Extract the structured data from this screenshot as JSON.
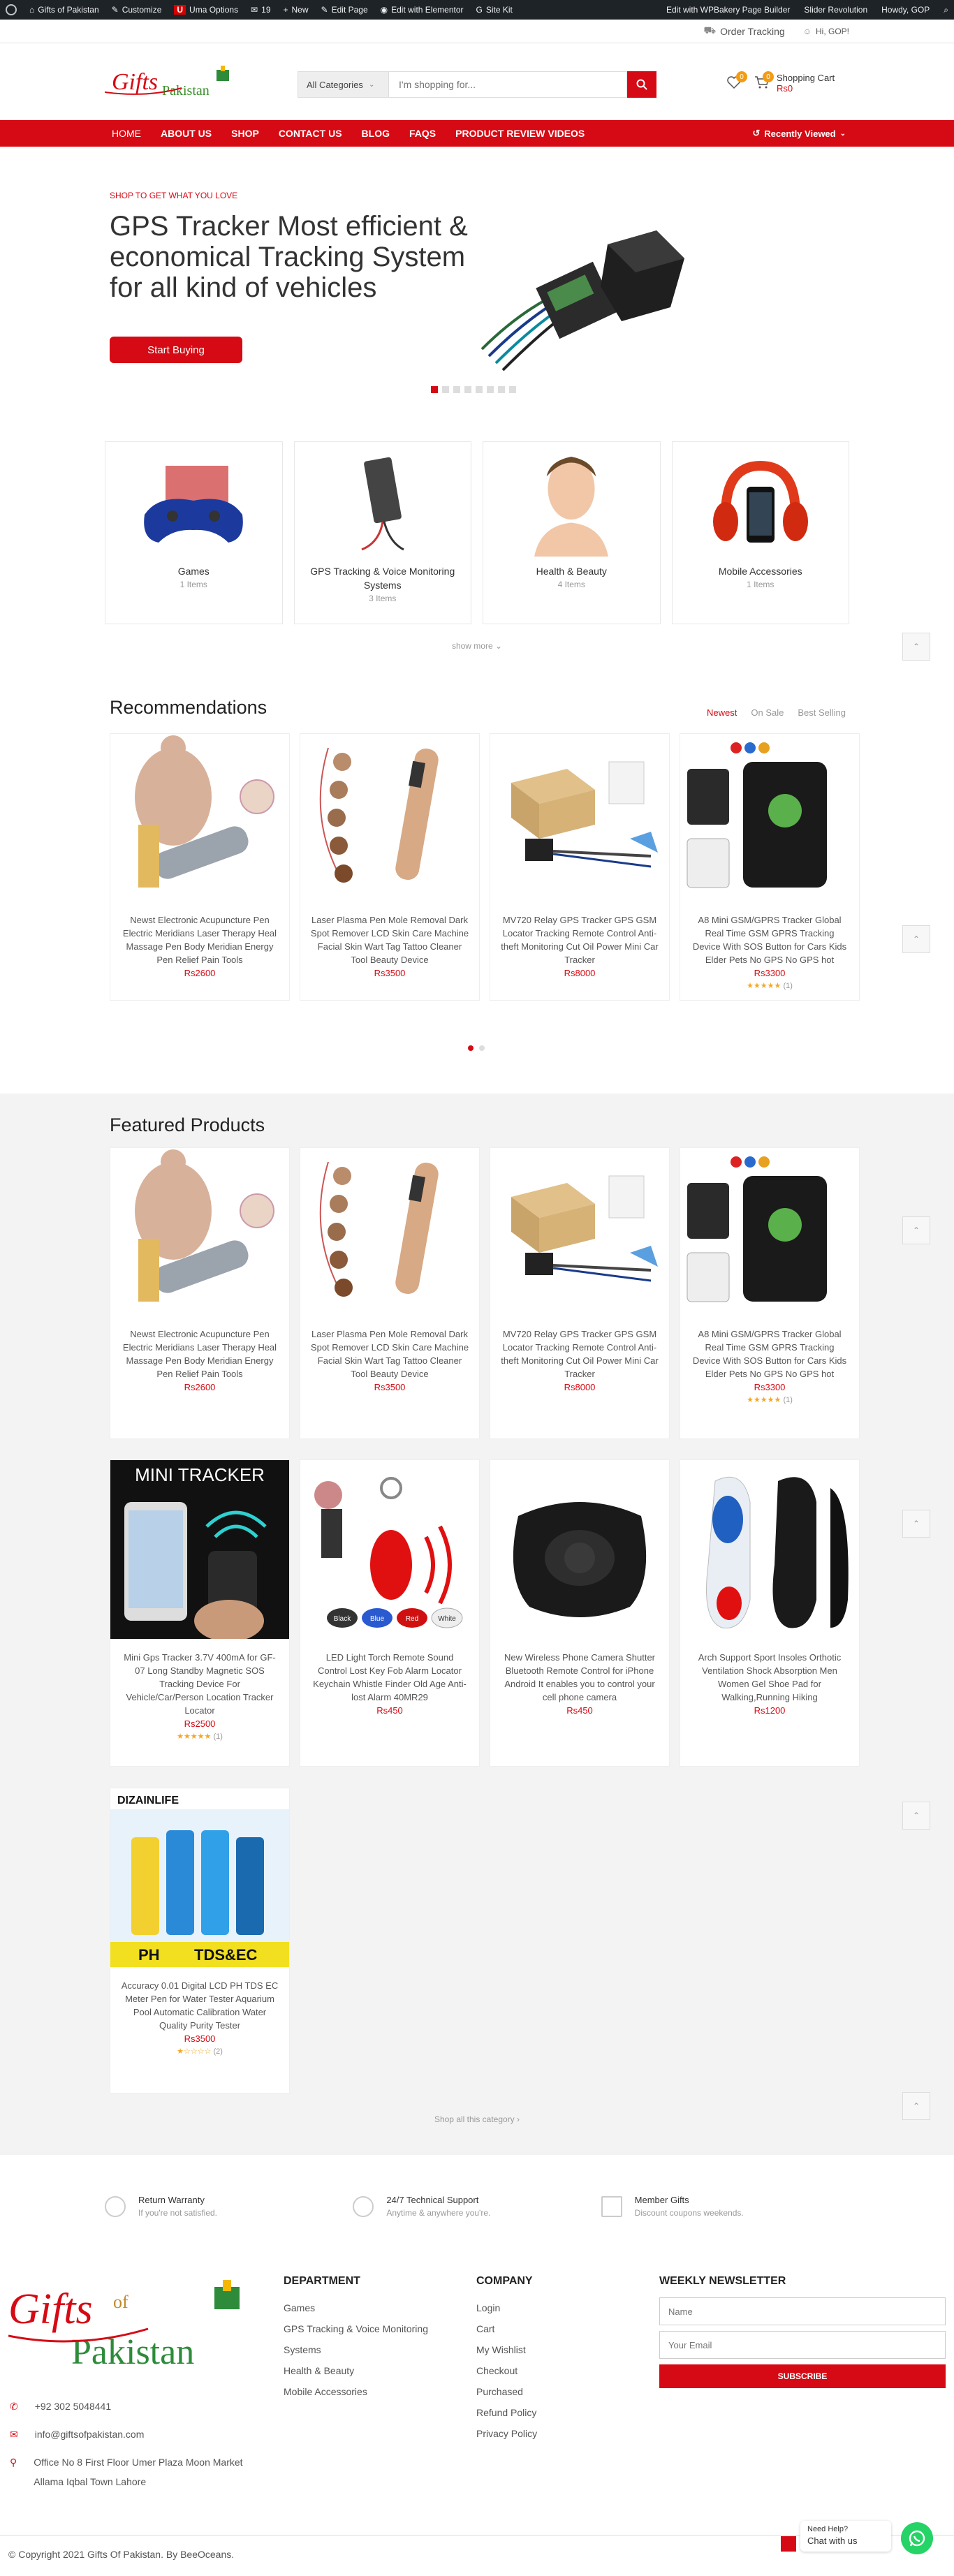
{
  "adminbar": {
    "site": "Gifts of Pakistan",
    "customize": "Customize",
    "uma": "Uma Options",
    "comments": "19",
    "new": "New",
    "edit_page": "Edit Page",
    "elementor": "Edit with Elementor",
    "sitekit": "Site Kit",
    "wpbakery": "Edit with WPBakery Page Builder",
    "slider": "Slider Revolution",
    "howdy": "Howdy, GOP"
  },
  "topbar": {
    "order_tracking": "Order Tracking",
    "greeting": "Hi, GOP!"
  },
  "header": {
    "category_select": "All Categories",
    "search_placeholder": "I'm shopping for...",
    "wishlist_count": "0",
    "cart_count": "0",
    "cart_label": "Shopping Cart",
    "cart_total": "Rs0"
  },
  "nav": {
    "items": [
      "HOME",
      "ABOUT US",
      "SHOP",
      "CONTACT US",
      "BLOG",
      "FAQS",
      "PRODUCT REVIEW VIDEOS"
    ],
    "recently_viewed": "Recently Viewed"
  },
  "hero": {
    "kicker": "SHOP TO GET WHAT YOU LOVE",
    "title": "GPS Tracker Most efficient & economical Tracking System for all kind of vehicles",
    "button": "Start Buying"
  },
  "categories": [
    {
      "name": "Games",
      "count": "1 Items"
    },
    {
      "name": "GPS Tracking & Voice Monitoring Systems",
      "count": "3 Items"
    },
    {
      "name": "Health & Beauty",
      "count": "4 Items"
    },
    {
      "name": "Mobile Accessories",
      "count": "1 Items"
    }
  ],
  "show_more": "show more",
  "recommendations": {
    "title": "Recommendations",
    "tabs": [
      "Newest",
      "On Sale",
      "Best Selling"
    ],
    "products": [
      {
        "name": "Newst Electronic Acupuncture Pen Electric Meridians Laser Therapy Heal Massage Pen Body Meridian Energy Pen Relief Pain Tools",
        "price": "Rs2600"
      },
      {
        "name": "Laser Plasma Pen Mole Removal Dark Spot Remover LCD Skin Care Machine Facial Skin Wart Tag Tattoo Cleaner Tool Beauty Device",
        "price": "Rs3500"
      },
      {
        "name": "MV720 Relay GPS Tracker GPS GSM Locator Tracking Remote Control Anti-theft Monitoring Cut Oil Power Mini Car Tracker",
        "price": "Rs8000"
      },
      {
        "name": "A8 Mini GSM/GPRS Tracker Global Real Time GSM GPRS Tracking Device With SOS Button for Cars Kids Elder Pets No GPS No GPS hot",
        "price": "Rs3300",
        "stars": "★★★★★",
        "reviews": "(1)"
      }
    ]
  },
  "featured": {
    "title": "Featured Products",
    "products": [
      {
        "name": "Newst Electronic Acupuncture Pen Electric Meridians Laser Therapy Heal Massage Pen Body Meridian Energy Pen Relief Pain Tools",
        "price": "Rs2600"
      },
      {
        "name": "Laser Plasma Pen Mole Removal Dark Spot Remover LCD Skin Care Machine Facial Skin Wart Tag Tattoo Cleaner Tool Beauty Device",
        "price": "Rs3500"
      },
      {
        "name": "MV720 Relay GPS Tracker GPS GSM Locator Tracking Remote Control Anti-theft Monitoring Cut Oil Power Mini Car Tracker",
        "price": "Rs8000"
      },
      {
        "name": "A8 Mini GSM/GPRS Tracker Global Real Time GSM GPRS Tracking Device With SOS Button for Cars Kids Elder Pets No GPS No GPS hot",
        "price": "Rs3300",
        "stars": "★★★★★",
        "reviews": "(1)"
      },
      {
        "name": "Mini Gps Tracker 3.7V 400mA for GF-07 Long Standby Magnetic SOS Tracking Device For Vehicle/Car/Person Location Tracker Locator",
        "price": "Rs2500",
        "stars": "★★★★★",
        "reviews": "(1)"
      },
      {
        "name": "LED Light Torch Remote Sound Control Lost Key Fob Alarm Locator Keychain Whistle Finder Old Age Anti-lost Alarm 40MR29",
        "price": "Rs450"
      },
      {
        "name": "New Wireless Phone Camera Shutter Bluetooth Remote Control for iPhone Android It enables you to control your cell phone camera",
        "price": "Rs450"
      },
      {
        "name": "Arch Support Sport Insoles Orthotic Ventilation Shock Absorption Men Women Gel Shoe Pad for Walking,Running Hiking",
        "price": "Rs1200"
      },
      {
        "name": "Accuracy 0.01 Digital LCD PH TDS EC Meter Pen for Water Tester Aquarium Pool Automatic Calibration Water Quality Purity Tester",
        "price": "Rs3500",
        "stars": "★☆☆☆☆",
        "reviews": "(2)"
      }
    ],
    "img_text": {
      "mini_tracker": "MINI TRACKER",
      "key_black": "Black",
      "key_blue": "Blue",
      "key_red": "Red",
      "key_white": "White",
      "ph": "PH",
      "tds": "TDS&EC",
      "brand": "DIZAINLIFE"
    },
    "shop_all": "Shop all this category"
  },
  "features": [
    {
      "title": "Return Warranty",
      "sub": "If you're not satisfied."
    },
    {
      "title": "24/7 Technical Support",
      "sub": "Anytime & anywhere you're."
    },
    {
      "title": "Member Gifts",
      "sub": "Discount coupons weekends."
    }
  ],
  "footer": {
    "logo_text": "Gifts of Pakistan",
    "phone": "+92 302 5048441",
    "email": "info@giftsofpakistan.com",
    "address": "Office No 8 First Floor Umer Plaza Moon Market Allama Iqbal Town Lahore",
    "department": {
      "title": "DEPARTMENT",
      "links": [
        "Games",
        "GPS Tracking & Voice Monitoring Systems",
        "Health & Beauty",
        "Mobile Accessories"
      ]
    },
    "company": {
      "title": "COMPANY",
      "links": [
        "Login",
        "Cart",
        "My Wishlist",
        "Checkout",
        "Purchased",
        "Refund Policy",
        "Privacy Policy"
      ]
    },
    "newsletter": {
      "title": "WEEKLY NEWSLETTER",
      "name_placeholder": "Name",
      "email_placeholder": "Your Email",
      "button": "SUBSCRIBE"
    },
    "copyright": "© Copyright 2021 Gifts Of Pakistan. By BeeOceans.",
    "chat_help": "Need Help?",
    "chat_label": "Chat with us"
  },
  "colors": {
    "brand_red": "#d60a14",
    "admin_bar": "#1d2327",
    "whatsapp": "#25d366"
  }
}
